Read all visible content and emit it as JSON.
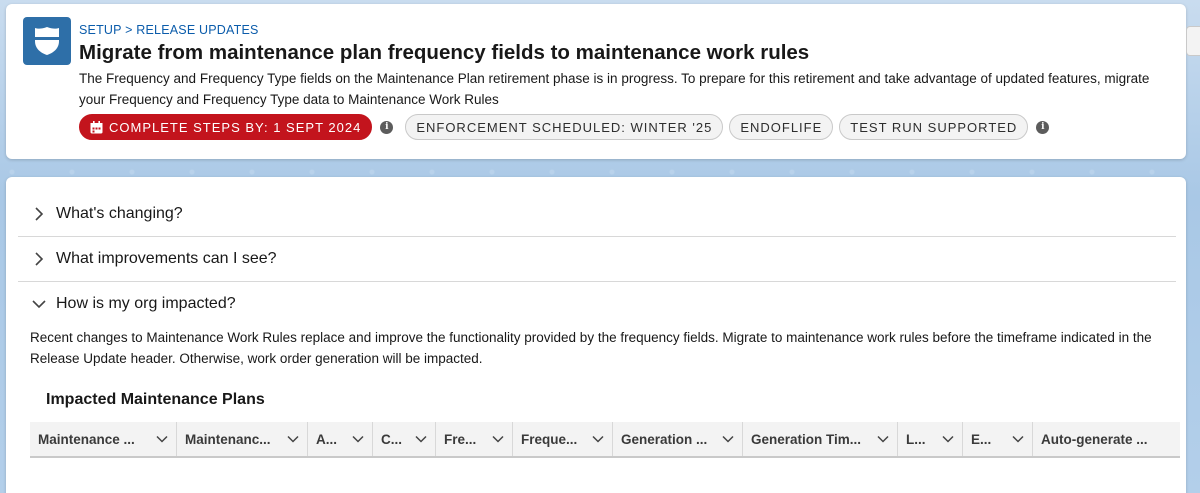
{
  "header": {
    "breadcrumb": "SETUP > RELEASE UPDATES",
    "title": "Migrate from maintenance plan frequency fields to maintenance work rules",
    "description": "The Frequency and Frequency Type fields on the Maintenance Plan retirement phase is in progress. To prepare for this retirement and take advantage of updated features, migrate your Frequency and Frequency Type data to Maintenance Work Rules",
    "badges": {
      "deadline": "COMPLETE STEPS BY: 1 SEPT 2024",
      "enforcement": "ENFORCEMENT SCHEDULED: WINTER '25",
      "endoflife": "ENDOFLIFE",
      "test_run": "TEST RUN SUPPORTED"
    },
    "icon": "shield-icon",
    "colors": {
      "accent": "#2e6fa8",
      "deadline_bg": "#c3141d",
      "link": "#0b5cab"
    }
  },
  "sections": [
    {
      "label": "What's changing?",
      "expanded": false
    },
    {
      "label": "What improvements can I see?",
      "expanded": false
    },
    {
      "label": "How is my org impacted?",
      "expanded": true
    }
  ],
  "impact_text": "Recent changes to Maintenance Work Rules replace and improve the functionality provided by the frequency fields. Migrate to maintenance work rules before the timeframe indicated in the Release Update header. Otherwise, work order generation will be impacted.",
  "table": {
    "title": "Impacted Maintenance Plans",
    "columns": [
      "Maintenance ...",
      "Maintenanc...",
      "A...",
      "C...",
      "Fre...",
      "Freque...",
      "Generation ...",
      "Generation Tim...",
      "L...",
      "E...",
      "Auto-generate ..."
    ]
  }
}
